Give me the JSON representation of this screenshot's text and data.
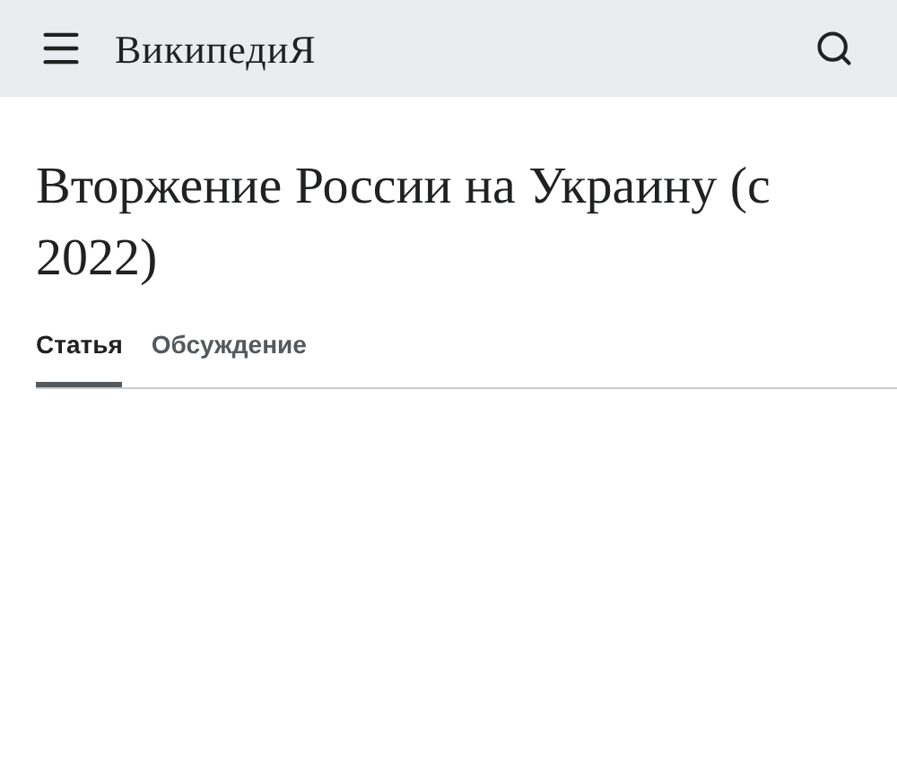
{
  "header": {
    "logo": "ВикипедиЯ"
  },
  "title": "Вторжение России на Украину (с 2022)",
  "tabs": [
    {
      "label": "Статья",
      "selected": true
    },
    {
      "label": "Обсуждение",
      "selected": false
    }
  ]
}
